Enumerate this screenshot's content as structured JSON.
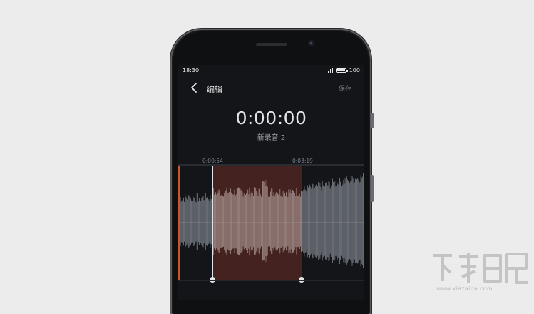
{
  "status_bar": {
    "time": "18:30",
    "battery": "100"
  },
  "toolbar": {
    "title": "编辑",
    "save_label": "保存"
  },
  "player": {
    "elapsed": "0:00:00",
    "recording_name": "新录音 2"
  },
  "selection": {
    "start_time": "0:00:54",
    "end_time": "0:03:19"
  },
  "watermark": {
    "site": "www.xiazaiba.com"
  },
  "colors": {
    "selection_fill": "#622a24",
    "accent_marker": "#c9562e",
    "waveform": "#9aa0aa"
  }
}
